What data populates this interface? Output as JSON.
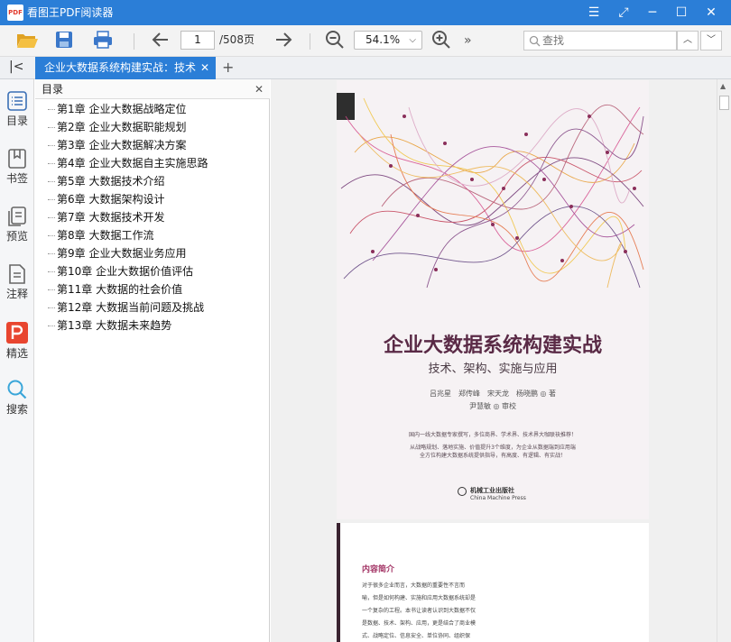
{
  "app": {
    "logo_text": "PDF",
    "title": "看图王PDF阅读器"
  },
  "window_controls": {
    "menu": "☰",
    "fullscreen": "⤢",
    "minimize": "─",
    "maximize": "☐",
    "close": "✕"
  },
  "toolbar": {
    "open_icon": "folder-open-icon",
    "save_icon": "save-icon",
    "print_icon": "print-icon",
    "prev_icon": "arrow-left-icon",
    "page_current": "1",
    "page_total": "/508页",
    "next_icon": "arrow-right-icon",
    "zoom_out_icon": "zoom-out-icon",
    "zoom_value": "54.1%",
    "zoom_dropdown": "⌵",
    "zoom_in_icon": "zoom-in-icon",
    "more": "»",
    "search_placeholder": "查找",
    "search_prev": "︿",
    "search_next": "﹀"
  },
  "tabs": {
    "collapse": "|<",
    "items": [
      {
        "label": "企业大数据系统构建实战：技术"
      }
    ],
    "close": "✕",
    "add": "+"
  },
  "sidebar": {
    "items": [
      {
        "label": "目录",
        "icon": "toc-icon"
      },
      {
        "label": "书签",
        "icon": "bookmark-icon"
      },
      {
        "label": "预览",
        "icon": "preview-icon"
      },
      {
        "label": "注释",
        "icon": "annotation-icon"
      },
      {
        "label": "精选",
        "icon": "featured-icon"
      },
      {
        "label": "搜索",
        "icon": "search-icon"
      }
    ]
  },
  "toc": {
    "title": "目录",
    "close": "✕",
    "items": [
      "第1章 企业大数据战略定位",
      "第2章 企业大数据职能规划",
      "第3章 企业大数据解决方案",
      "第4章 企业大数据自主实施思路",
      "第5章 大数据技术介绍",
      "第6章 大数据架构设计",
      "第7章 大数据技术开发",
      "第8章 大数据工作流",
      "第9章 企业大数据业务应用",
      "第10章 企业大数据价值评估",
      "第11章 大数据的社会价值",
      "第12章 大数据当前问题及挑战",
      "第13章 大数据未来趋势"
    ]
  },
  "document": {
    "cover": {
      "title": "企业大数据系统构建实战",
      "subtitle": "技术、架构、实施与应用",
      "authors": "吕兆星　郑传峰　宋天龙　杨晓鹏 ◎ 著",
      "reviewer": "尹慧敏 ◎ 审校",
      "blurb1": "国内一线大数据专家撰写，多位商界、学术界、技术界大咖联袂推荐！",
      "blurb2": "从战略规划、落地实施、价值提升3个维度，为企业从数据端到应用端",
      "blurb3": "全方位构建大数据系统提供指导，有高度、有逻辑、有实战！",
      "publisher_cn": "机械工业出版社",
      "publisher_en": "China Machine Press"
    },
    "page2": {
      "heading": "内容简介",
      "lines": [
        "对于很多企业而言，大数据的重要性不言而",
        "喻，但是如何构建、实施和应用大数据系统却是",
        "一个复杂的工程。本书让读者认识到大数据不仅",
        "是数据、技术、架构、应用，更是结合了商业模",
        "式、战略定位、信息安全、单位协同、组织保"
      ]
    }
  },
  "colors": {
    "accent": "#2b7ed7",
    "cover_title": "#5a2a46",
    "page2_heading": "#a33566"
  }
}
